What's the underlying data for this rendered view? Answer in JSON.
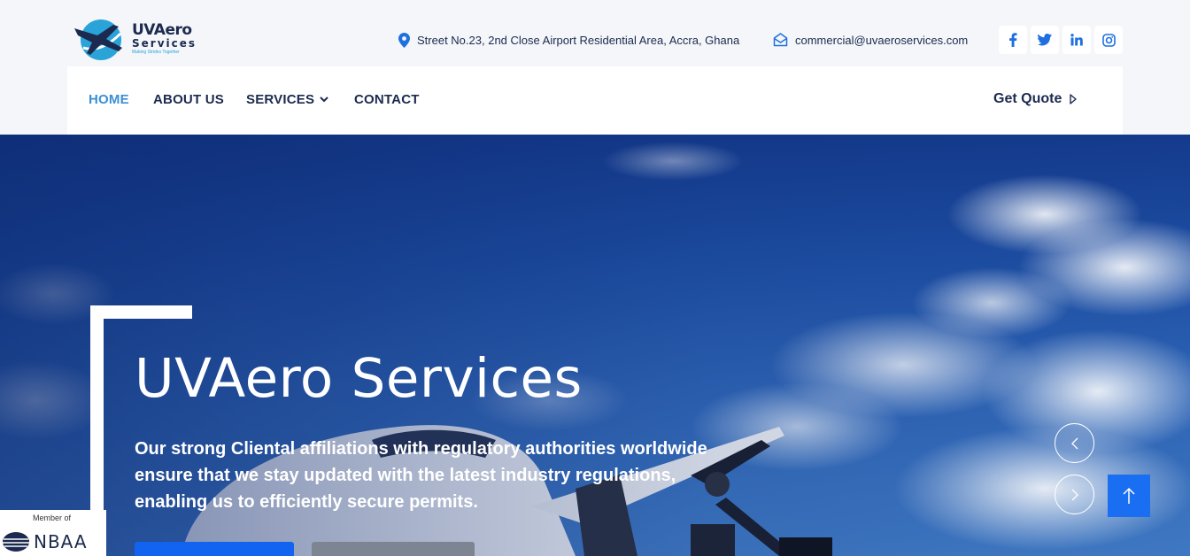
{
  "logo": {
    "brand": "UVAero",
    "sub": "Services",
    "tagline": "Making Strides Together"
  },
  "contact": {
    "address": "Street No.23, 2nd Close Airport Residential Area, Accra, Ghana",
    "email": "commercial@uvaeroservices.com"
  },
  "social": [
    "facebook-icon",
    "twitter-icon",
    "linkedin-icon",
    "instagram-icon"
  ],
  "nav": {
    "items": [
      {
        "label": "HOME",
        "active": true
      },
      {
        "label": "ABOUT US",
        "active": false
      },
      {
        "label": "SERVICES",
        "active": false,
        "dropdown": true
      },
      {
        "label": "CONTACT",
        "active": false
      }
    ],
    "cta": "Get Quote"
  },
  "hero": {
    "title": "UVAero Services",
    "text": "Our strong Cliental affiliations with regulatory authorities worldwide ensure that we stay updated with the latest industry regulations, enabling us to efficiently secure permits."
  },
  "badge": {
    "member_of": "Member of",
    "org": "NBAA"
  },
  "colors": {
    "navy": "#1b2a4e",
    "accent": "#3a8fd6",
    "primary_button": "#1163f0",
    "scroll_top": "#1a6ef2"
  }
}
